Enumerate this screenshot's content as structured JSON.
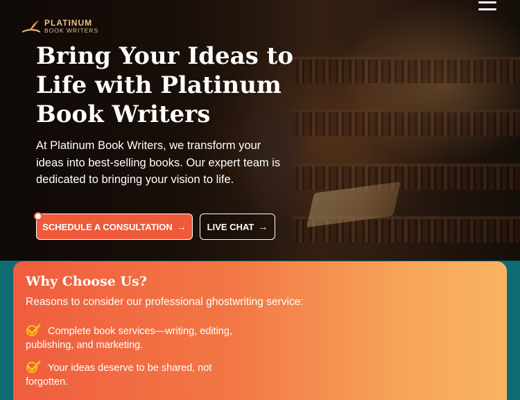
{
  "brand": {
    "name_line1": "PLATINUM",
    "name_line2": "BOOK WRITERS"
  },
  "hero": {
    "headline": "Bring Your Ideas to Life with Platinum Book Writers",
    "intro": "At Platinum Book Writers, we transform your ideas into best-selling books. Our expert team is dedicated to bringing your vision to life.",
    "primary_button": "SCHEDULE A CONSULTATION",
    "secondary_button": "LIVE CHAT",
    "arrow_glyph": "→"
  },
  "why": {
    "title": "Why Choose Us?",
    "subtitle": "Reasons to consider our professional ghostwriting service:",
    "items": [
      "Complete book services—writing, editing, publishing, and marketing.",
      "Your ideas deserve to be shared, not forgotten."
    ]
  },
  "colors": {
    "accent": "#ee5a3a",
    "card_gradient_start": "#f05d3e",
    "card_gradient_end": "#f9b35f",
    "teal_background": "#0f6b73",
    "logo_gold": "#e7c08a",
    "check_yellow": "#f4c21a"
  },
  "icons": {
    "menu": "hamburger-menu-icon",
    "logo": "quill-book-icon",
    "check": "checkmark-icon",
    "arrow": "arrow-right-icon"
  }
}
